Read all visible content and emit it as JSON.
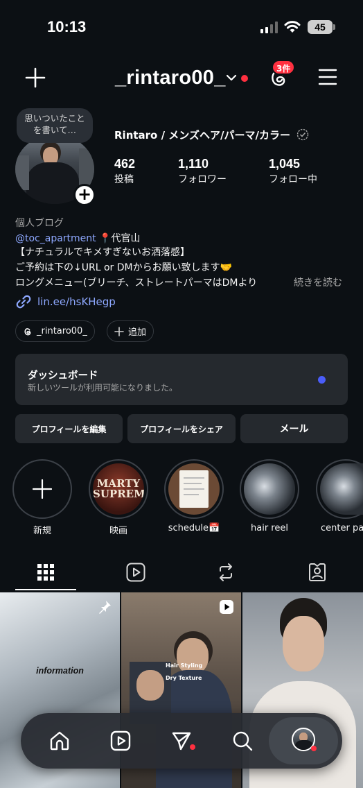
{
  "status_bar": {
    "time": "10:13",
    "battery": "45",
    "icons": [
      "signal-icon",
      "wifi-icon",
      "battery-icon"
    ]
  },
  "header": {
    "username": "_rintaro00_",
    "threads_badge": "3件",
    "icons": [
      "plus-icon",
      "chevron-down-icon",
      "threads-icon",
      "menu-icon"
    ]
  },
  "profile": {
    "note": "思いついたことを書いて…",
    "display_name": "Rintaro / メンズヘア/パーマ/カラー",
    "stats": [
      {
        "value": "462",
        "label": "投稿"
      },
      {
        "value": "1,110",
        "label": "フォロワー"
      },
      {
        "value": "1,045",
        "label": "フォロー中"
      }
    ],
    "category": "個人ブログ",
    "mention": "@toc_apartment",
    "location": "📍代官山",
    "bio_lines": [
      "【ナチュラルでキメすぎないお洒落感】",
      "ご予約は下の↓URL or DMからお願い致します🤝",
      "ロングメニュー(ブリーチ、ストレートパーマはDMより"
    ],
    "more": "続きを読む",
    "link": "lin.ee/hsKHegp",
    "chips": [
      {
        "label": "_rintaro00_",
        "icon": "threads-icon"
      },
      {
        "label": "追加",
        "icon": "plus-icon"
      }
    ]
  },
  "dashboard": {
    "title": "ダッシュボード",
    "subtitle": "新しいツールが利用可能になりました。",
    "accent": "#4a5df9"
  },
  "buttons": {
    "edit": "プロフィールを編集",
    "share": "プロフィールをシェア",
    "mail": "メール"
  },
  "highlights": [
    {
      "label": "新規"
    },
    {
      "label": "映画",
      "cover_text": "MARTY SUPREME"
    },
    {
      "label": "schedule📅"
    },
    {
      "label": "hair reel"
    },
    {
      "label": "center pa"
    }
  ],
  "tabs": [
    "grid-icon",
    "reels-icon",
    "repost-icon",
    "tagged-icon"
  ],
  "grid": {
    "tile1_text": "information",
    "tile2_overlay1": "Hair Styling",
    "tile2_overlay2": "Dry Texture"
  },
  "bottom_nav": [
    "home-icon",
    "reels-icon",
    "send-icon",
    "search-icon",
    "profile-avatar"
  ],
  "colors": {
    "background": "#0c1014",
    "link": "#8ea8ff",
    "notification": "#ff3040",
    "surface": "#25292e"
  }
}
